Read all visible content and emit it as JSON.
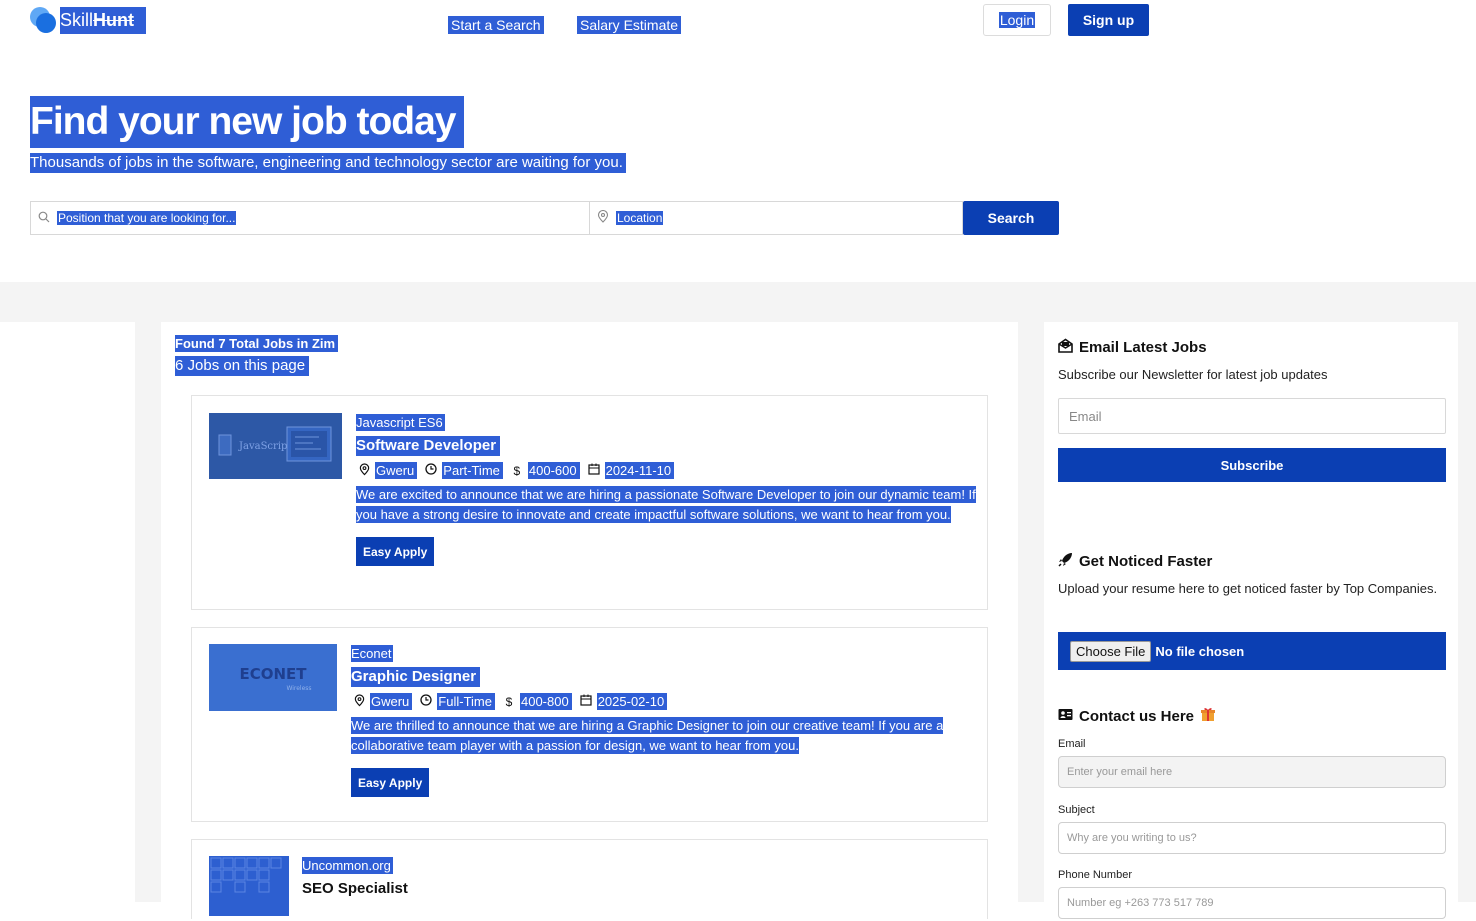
{
  "header": {
    "logo_part1": "Skill",
    "logo_part2": "Hunt",
    "nav": [
      "Start a Search",
      "Salary Estimate"
    ],
    "login": "Login",
    "signup": "Sign up"
  },
  "hero": {
    "title": "Find your new job today",
    "subtitle": "Thousands of jobs in the software, engineering and technology sector are waiting for you.",
    "position_placeholder": "Position that you are looking for...",
    "location_placeholder": "Location",
    "search_button": "Search"
  },
  "results": {
    "found": "Found 7 Total Jobs in Zim",
    "on_page": "6 Jobs on this page"
  },
  "jobs": [
    {
      "company": "Javascript ES6",
      "title": "Software Developer",
      "location": "Gweru",
      "type": "Part-Time",
      "salary": "400-600",
      "date": "2024-11-10",
      "description": "We are excited to announce that we are hiring a passionate Software Developer to join our dynamic team! If you have a strong desire to innovate and create impactful software solutions, we want to hear from you.",
      "apply": "Easy Apply",
      "logo_text": "JavaScript"
    },
    {
      "company": "Econet",
      "title": "Graphic Designer",
      "location": "Gweru",
      "type": "Full-Time",
      "salary": "400-800",
      "date": "2025-02-10",
      "description": "We are thrilled to announce that we are hiring a Graphic Designer to join our creative team! If you are a collaborative team player with a passion for design, we want to hear from you.",
      "apply": "Easy Apply",
      "logo_text": "ECONET",
      "logo_subtext": "Wireless"
    },
    {
      "company": "Uncommon.org",
      "title": "SEO Specialist"
    }
  ],
  "sidebar": {
    "email_heading": "Email Latest Jobs",
    "email_text": "Subscribe our Newsletter for latest job updates",
    "email_placeholder": "Email",
    "subscribe": "Subscribe",
    "noticed_heading": "Get Noticed Faster",
    "noticed_text": "Upload your resume here to get noticed faster by Top Companies.",
    "choose_file": "Choose File",
    "no_file": "No file chosen",
    "contact_heading": "Contact us Here",
    "contact_email_label": "Email",
    "contact_email_placeholder": "Enter your email here",
    "subject_label": "Subject",
    "subject_placeholder": "Why are you writing to us?",
    "phone_label": "Phone Number",
    "phone_placeholder": "Number eg +263 773 517 789"
  },
  "colors": {
    "accent": "#0b3fb3",
    "selection": "#2f5ed6",
    "background_gray": "#f4f4f4"
  }
}
